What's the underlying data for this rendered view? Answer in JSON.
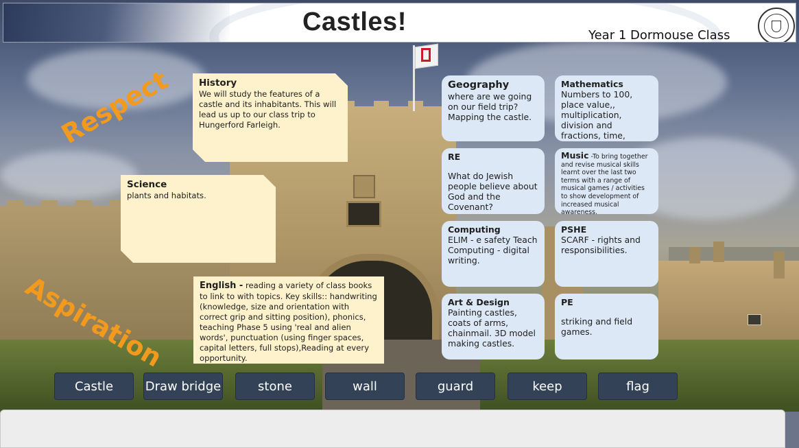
{
  "header": {
    "title": "Castles!",
    "subtitle": "Year 1 Dormouse Class"
  },
  "values": {
    "respect": "Respect",
    "aspiration": "Aspiration"
  },
  "notes": {
    "history": {
      "heading": "History",
      "text": "We will study the features of a castle and its inhabitants. This will lead us up to our class trip to Hungerford Farleigh."
    },
    "science": {
      "heading": "Science",
      "text": "plants and habitats."
    },
    "english": {
      "heading": "English -",
      "text": " reading a variety of class books to link to with topics. Key skills::  handwriting (knowledge, size and orientation with correct grip and sitting position), phonics, teaching Phase 5 using  'real and alien words', punctuation (using finger spaces, capital letters, full stops),Reading at every opportunity."
    }
  },
  "subjects": {
    "geography": {
      "heading": "Geography",
      "text": "where are we going on our field trip? Mapping the castle."
    },
    "mathematics": {
      "heading": "Mathematics",
      "text": "Numbers to 100, place value,, multiplication, division and fractions, time, money."
    },
    "re": {
      "heading": "RE",
      "text": "What do Jewish people believe about God and the Covenant?"
    },
    "music": {
      "heading": "Music",
      "text": " -To bring together and revise musical skills learnt over the last two terms with a range of musical games / activities to show development of increased musical awareness."
    },
    "computing": {
      "heading": "Computing",
      "text": "ELIM - e safety Teach Computing - digital writing."
    },
    "pshe": {
      "heading": "PSHE",
      "text": "SCARF - rights and responsibilities."
    },
    "art": {
      "heading": "Art & Design",
      "text": "Painting castles, coats of arms, chainmail. 3D model making castles."
    },
    "pe": {
      "heading": "PE",
      "text": "striking and field games."
    }
  },
  "vocabulary": [
    "Castle",
    "Draw bridge",
    "stone",
    "wall",
    "guard",
    "keep",
    "flag"
  ],
  "colors": {
    "accent_orange": "#f29a1e",
    "note_cream": "#fdf2cc",
    "card_blue": "#dce8f6",
    "vocab_button": "#334256"
  }
}
